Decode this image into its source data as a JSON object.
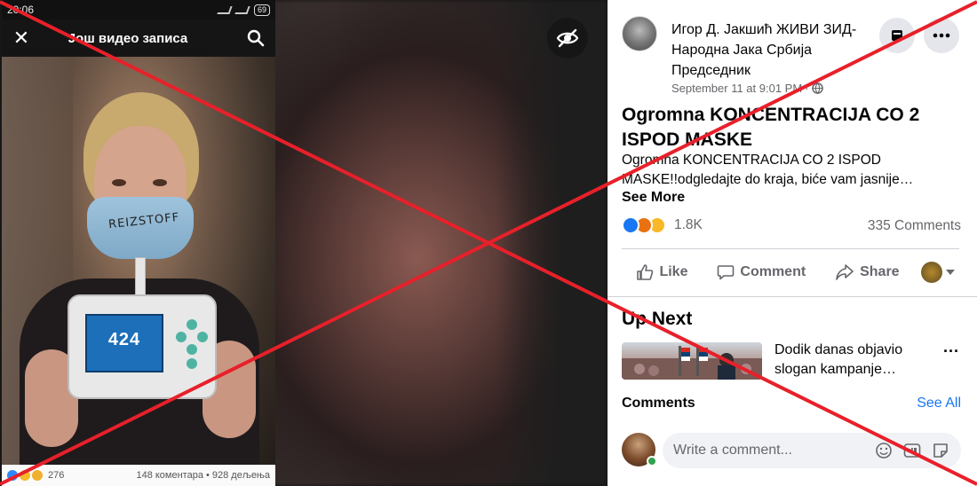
{
  "phone": {
    "status_time": "20:06",
    "battery": "69",
    "header_title": "Још видео записа",
    "mask_text": "REIZSTOFF",
    "device_reading": "424",
    "footer_reaction_count": "276",
    "footer_stats": "148 коментара • 928 дељења"
  },
  "post": {
    "author": "Игор Д. Јакшић ЖИВИ ЗИД-Народна Јака Србија Председник",
    "date": "September 11 at 9:01 PM",
    "date_separator": "·",
    "title": "Ogromna KONCENTRACIJA CO 2 ISPOD MASKE",
    "text": "Ogromna KONCENTRACIJA CO 2 ISPOD MASKE!!odgledajte do kraja, biće vam jasnije…",
    "see_more": "See More",
    "reaction_count": "1.8K",
    "comment_count": "335 Comments",
    "actions": {
      "like": "Like",
      "comment": "Comment",
      "share": "Share"
    }
  },
  "up_next": {
    "title": "Up Next",
    "caption": "Dodik danas objavio slogan kampanje…",
    "more": "···"
  },
  "comments": {
    "label": "Comments",
    "see_all": "See All",
    "input_placeholder": "Write a comment..."
  },
  "colors": {
    "accent": "#1877f2",
    "overlay_x": "#e8202a",
    "online": "#31a24c"
  },
  "icons": [
    "close-icon",
    "search-icon",
    "hidden-eye-icon",
    "globe-icon",
    "bookmark-icon",
    "more-icon",
    "like-icon",
    "comment-icon",
    "share-icon",
    "emoji-icon",
    "gif-icon",
    "sticker-icon"
  ]
}
